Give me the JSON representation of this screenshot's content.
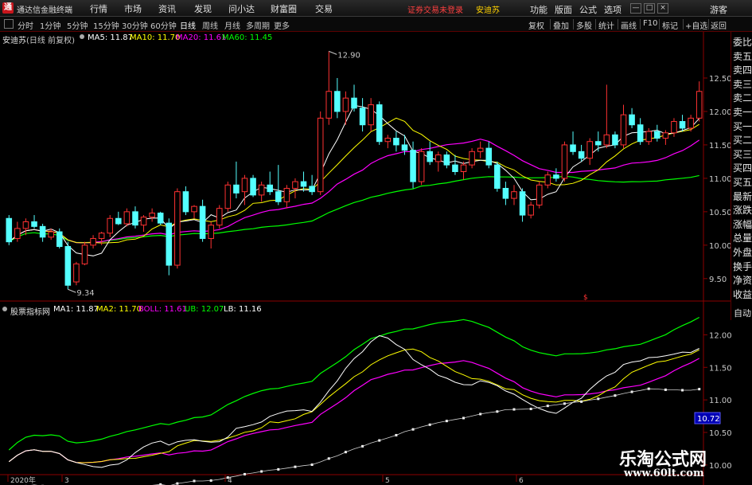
{
  "app": {
    "title": "通达信金融终端",
    "logo": "通",
    "menu": [
      "行情",
      "市场",
      "资讯",
      "发现",
      "问小达",
      "财富圈",
      "交易"
    ],
    "login_status": "证券交易未登录",
    "stock_tag": "安迪苏",
    "right_menu": [
      "功能",
      "版面",
      "公式",
      "选项",
      "游客"
    ],
    "window_buttons": [
      "—",
      "□",
      "×"
    ]
  },
  "toolbar": {
    "periods": [
      "分时",
      "1分钟",
      "5分钟",
      "15分钟",
      "30分钟",
      "60分钟",
      "日线",
      "周线",
      "月线",
      "多周期",
      "更多"
    ],
    "active_period": "日线",
    "tools": [
      "复权",
      "叠加",
      "多股",
      "统计",
      "画线",
      "F10",
      "标记",
      "+自选",
      "返回"
    ]
  },
  "main_chart": {
    "stock_name": "安迪苏",
    "period_label": "(日线 前复权)",
    "ma_labels": [
      {
        "text": "MA5: 11.87",
        "color": "#ffffff"
      },
      {
        "text": "MA10: 11.70",
        "color": "#ffff00"
      },
      {
        "text": "MA20: 11.61",
        "color": "#ff00ff"
      },
      {
        "text": "MA60: 11.45",
        "color": "#00ff00"
      }
    ],
    "y_ticks": [
      "12.50",
      "12.00",
      "11.50",
      "11.00",
      "10.50",
      "10.00",
      "9.50"
    ],
    "high_label": "12.90",
    "low_label": "9.34",
    "marker": "$"
  },
  "side_panel": [
    "委比",
    "卖五",
    "卖四",
    "卖三",
    "卖二",
    "卖一",
    "买一",
    "买二",
    "买三",
    "买四",
    "买五",
    "最新",
    "涨跌",
    "涨幅",
    "总量",
    "外盘",
    "换手",
    "净资",
    "收益"
  ],
  "sub_chart": {
    "indicator_name": "股票指标网",
    "labels": [
      {
        "text": "MA1: 11.87",
        "color": "#ffffff"
      },
      {
        "text": "MA2: 11.70",
        "color": "#ffff00"
      },
      {
        "text": "BOLL: 11.61",
        "color": "#ff00ff"
      },
      {
        "text": "UB: 12.07",
        "color": "#00ff00"
      },
      {
        "text": "LB: 11.16",
        "color": "#ffffff"
      }
    ],
    "y_ticks": [
      "12.00",
      "11.50",
      "11.00",
      "10.50",
      "10.00"
    ],
    "current_value": "10.72",
    "auto_label": "自动"
  },
  "x_axis": {
    "labels": [
      "2020年",
      "3",
      "4",
      "5",
      "6"
    ]
  },
  "watermark": {
    "line1": "乐淘公式网",
    "line2": "www.60lt.com"
  },
  "colors": {
    "up": "#ff3232",
    "down": "#54ffff",
    "ma5": "#ffffff",
    "ma10": "#ffff00",
    "ma20": "#ff00ff",
    "ma60": "#00ff00",
    "axis_border": "#8c0000"
  },
  "chart_data": {
    "type": "candlestick",
    "period": "daily",
    "y_range": [
      9.2,
      13.0
    ],
    "ohlc": [
      [
        10.4,
        10.45,
        10.0,
        10.05
      ],
      [
        10.1,
        10.35,
        10.05,
        10.25
      ],
      [
        10.25,
        10.4,
        10.15,
        10.35
      ],
      [
        10.35,
        10.45,
        10.25,
        10.28
      ],
      [
        10.28,
        10.32,
        10.05,
        10.12
      ],
      [
        10.12,
        10.25,
        10.08,
        10.2
      ],
      [
        10.2,
        10.25,
        9.95,
        9.98
      ],
      [
        9.98,
        10.05,
        9.34,
        9.4
      ],
      [
        9.45,
        9.75,
        9.4,
        9.72
      ],
      [
        9.72,
        10.05,
        9.7,
        10.0
      ],
      [
        10.0,
        10.15,
        9.95,
        10.1
      ],
      [
        10.1,
        10.2,
        10.0,
        10.18
      ],
      [
        10.18,
        10.45,
        10.12,
        10.4
      ],
      [
        10.4,
        10.5,
        10.3,
        10.32
      ],
      [
        10.32,
        10.55,
        10.28,
        10.5
      ],
      [
        10.5,
        10.58,
        10.25,
        10.3
      ],
      [
        10.3,
        10.45,
        10.2,
        10.42
      ],
      [
        10.42,
        10.55,
        10.35,
        10.48
      ],
      [
        10.48,
        10.5,
        10.3,
        10.33
      ],
      [
        10.33,
        10.4,
        9.55,
        9.7
      ],
      [
        9.7,
        10.85,
        9.65,
        10.8
      ],
      [
        10.8,
        10.88,
        10.45,
        10.5
      ],
      [
        10.5,
        10.6,
        10.4,
        10.58
      ],
      [
        10.58,
        10.68,
        10.05,
        10.1
      ],
      [
        10.1,
        10.35,
        9.95,
        10.3
      ],
      [
        10.3,
        10.6,
        10.25,
        10.55
      ],
      [
        10.55,
        10.95,
        10.5,
        10.9
      ],
      [
        10.9,
        11.25,
        10.7,
        10.78
      ],
      [
        10.8,
        11.05,
        10.6,
        11.0
      ],
      [
        11.0,
        11.05,
        10.72,
        10.75
      ],
      [
        10.75,
        10.95,
        10.65,
        10.9
      ],
      [
        10.9,
        11.1,
        10.75,
        10.8
      ],
      [
        10.8,
        11.2,
        10.6,
        10.65
      ],
      [
        10.65,
        10.9,
        10.55,
        10.85
      ],
      [
        10.85,
        11.0,
        10.7,
        10.95
      ],
      [
        10.95,
        11.1,
        10.8,
        10.88
      ],
      [
        10.88,
        11.05,
        10.75,
        10.8
      ],
      [
        10.8,
        12.0,
        10.75,
        11.9
      ],
      [
        11.9,
        12.9,
        11.8,
        12.3
      ],
      [
        12.3,
        12.5,
        11.9,
        12.0
      ],
      [
        12.0,
        12.3,
        11.8,
        12.2
      ],
      [
        12.2,
        12.4,
        12.0,
        12.05
      ],
      [
        12.05,
        12.2,
        11.7,
        11.8
      ],
      [
        11.8,
        12.2,
        11.7,
        12.1
      ],
      [
        12.1,
        12.15,
        11.5,
        11.55
      ],
      [
        11.55,
        11.65,
        11.45,
        11.6
      ],
      [
        11.6,
        11.7,
        11.4,
        11.5
      ],
      [
        11.5,
        11.65,
        11.35,
        11.42
      ],
      [
        11.42,
        11.55,
        10.85,
        10.95
      ],
      [
        10.95,
        11.45,
        10.9,
        11.4
      ],
      [
        11.4,
        11.55,
        11.2,
        11.25
      ],
      [
        11.25,
        11.4,
        11.1,
        11.35
      ],
      [
        11.35,
        11.4,
        11.15,
        11.2
      ],
      [
        11.2,
        11.35,
        11.05,
        11.1
      ],
      [
        11.1,
        11.25,
        10.98,
        11.2
      ],
      [
        11.2,
        11.45,
        11.15,
        11.4
      ],
      [
        11.4,
        11.55,
        11.3,
        11.45
      ],
      [
        11.45,
        11.55,
        11.15,
        11.2
      ],
      [
        11.2,
        11.25,
        10.8,
        10.85
      ],
      [
        10.85,
        10.95,
        10.6,
        10.7
      ],
      [
        10.7,
        10.9,
        10.6,
        10.8
      ],
      [
        10.8,
        10.85,
        10.35,
        10.45
      ],
      [
        10.45,
        10.65,
        10.4,
        10.6
      ],
      [
        10.6,
        10.95,
        10.55,
        10.9
      ],
      [
        10.9,
        11.1,
        10.85,
        11.05
      ],
      [
        11.05,
        11.15,
        10.95,
        11.0
      ],
      [
        11.0,
        11.55,
        10.95,
        11.5
      ],
      [
        11.5,
        11.7,
        11.35,
        11.4
      ],
      [
        11.4,
        11.5,
        11.25,
        11.3
      ],
      [
        11.3,
        11.6,
        11.2,
        11.55
      ],
      [
        11.55,
        11.7,
        11.4,
        11.5
      ],
      [
        11.5,
        12.4,
        11.45,
        11.65
      ],
      [
        11.65,
        11.7,
        11.45,
        11.5
      ],
      [
        11.5,
        12.1,
        11.45,
        11.95
      ],
      [
        11.95,
        12.05,
        11.75,
        11.8
      ],
      [
        11.8,
        11.9,
        11.5,
        11.55
      ],
      [
        11.55,
        11.75,
        11.5,
        11.7
      ],
      [
        11.7,
        11.8,
        11.55,
        11.6
      ],
      [
        11.6,
        11.72,
        11.5,
        11.68
      ],
      [
        11.68,
        11.9,
        11.62,
        11.85
      ],
      [
        11.85,
        11.95,
        11.7,
        11.75
      ],
      [
        11.75,
        11.95,
        11.7,
        11.9
      ],
      [
        11.9,
        12.45,
        11.85,
        12.3
      ]
    ]
  }
}
